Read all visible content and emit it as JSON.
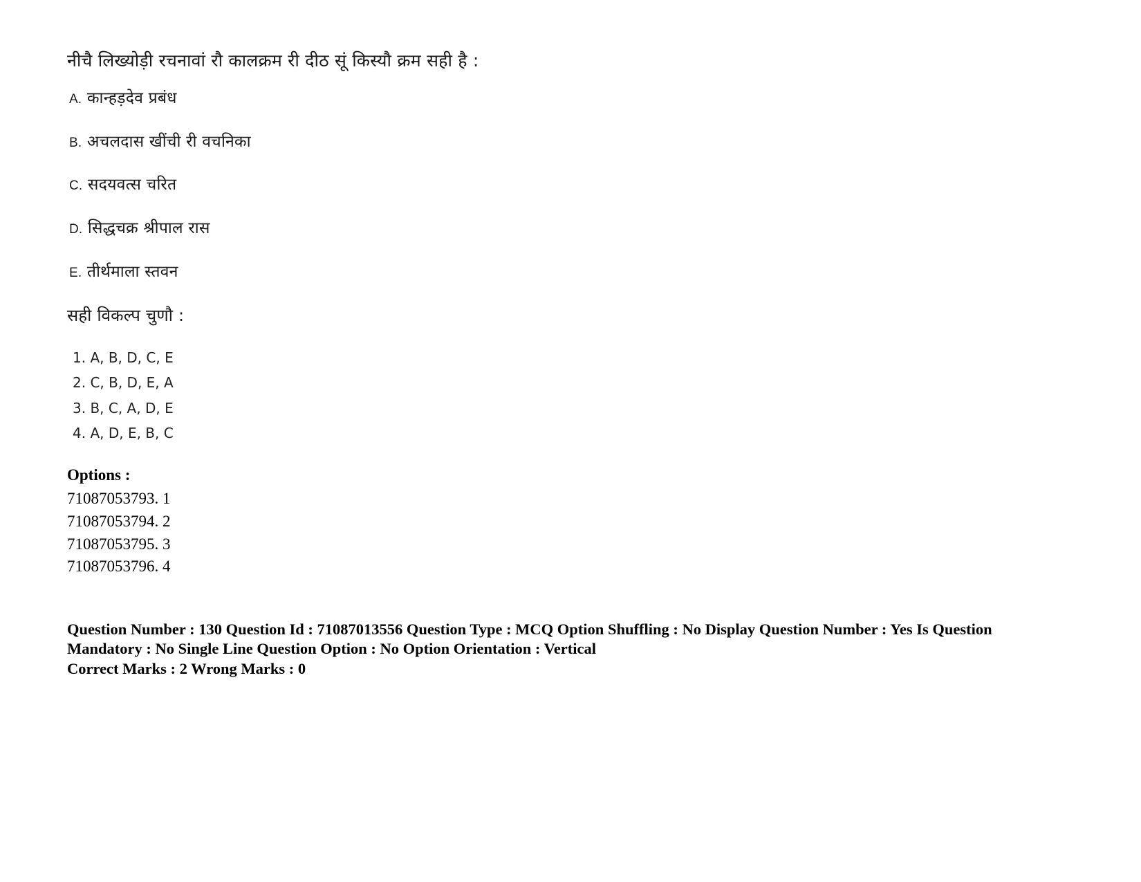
{
  "question": {
    "stem": "नीचै लिख्योड़ी रचनावां रौ कालक्रम री दीठ सूं किस्यौ क्रम सही है :",
    "items": [
      {
        "label": "A.",
        "text": "कान्हड़देव प्रबंध"
      },
      {
        "label": "B.",
        "text": "अचलदास खींची री वचनिका"
      },
      {
        "label": "C.",
        "text": "सदयवत्स चरित"
      },
      {
        "label": "D.",
        "text": "सिद्धचक्र श्रीपाल रास"
      },
      {
        "label": "E.",
        "text": "तीर्थमाला स्तवन"
      }
    ],
    "choose_label": "सही विकल्प चुणौ :",
    "choices": [
      "1. A, B, D, C, E",
      "2. C, B, D, E, A",
      "3. B, C, A, D, E",
      "4. A, D, E, B, C"
    ]
  },
  "options": {
    "title": "Options :",
    "rows": [
      "71087053793. 1",
      "71087053794. 2",
      "71087053795. 3",
      "71087053796. 4"
    ]
  },
  "meta": {
    "line1": "Question Number : 130 Question Id : 71087013556 Question Type : MCQ Option Shuffling : No Display Question Number : Yes Is Question Mandatory : No Single Line Question Option : No Option Orientation : Vertical",
    "line2": "Correct Marks : 2 Wrong Marks : 0"
  }
}
